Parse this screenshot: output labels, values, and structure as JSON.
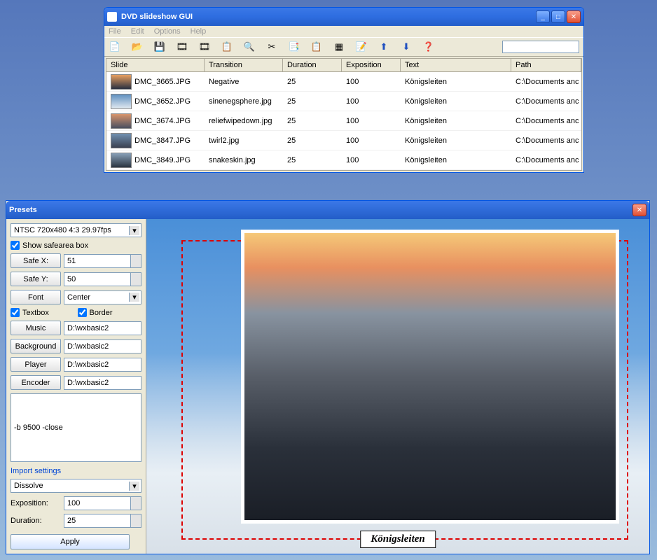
{
  "main": {
    "title": "DVD slideshow GUI",
    "menu": [
      "File",
      "Edit",
      "Options",
      "Help"
    ],
    "columns": [
      "Slide",
      "Transition",
      "Duration",
      "Exposition",
      "Text",
      "Path"
    ],
    "rows": [
      {
        "slide": "DMC_3665.JPG",
        "trans": "Negative",
        "dur": "25",
        "exp": "100",
        "text": "Königsleiten",
        "path": "C:\\Documents anc"
      },
      {
        "slide": "DMC_3652.JPG",
        "trans": "sinenegsphere.jpg",
        "dur": "25",
        "exp": "100",
        "text": "Königsleiten",
        "path": "C:\\Documents anc"
      },
      {
        "slide": "DMC_3674.JPG",
        "trans": "reliefwipedown.jpg",
        "dur": "25",
        "exp": "100",
        "text": "Königsleiten",
        "path": "C:\\Documents anc"
      },
      {
        "slide": "DMC_3847.JPG",
        "trans": "twirl2.jpg",
        "dur": "25",
        "exp": "100",
        "text": "Königsleiten",
        "path": "C:\\Documents anc"
      },
      {
        "slide": "DMC_3849.JPG",
        "trans": "snakeskin.jpg",
        "dur": "25",
        "exp": "100",
        "text": "Königsleiten",
        "path": "C:\\Documents anc"
      }
    ],
    "thumbs": [
      "linear-gradient(#e8a060,#2a3040)",
      "linear-gradient(#6090c0,#e0e8f0)",
      "linear-gradient(#d8946c,#4a5060)",
      "linear-gradient(#7090b0,#3a4050)",
      "linear-gradient(#88a0b8,#2a3440)"
    ]
  },
  "presets": {
    "title": "Presets",
    "format": "NTSC 720x480 4:3 29.97fps",
    "safearea_label": "Show safearea box",
    "safex_btn": "Safe X:",
    "safex_val": "51",
    "safey_btn": "Safe Y:",
    "safey_val": "50",
    "font_btn": "Font",
    "font_val": "Center",
    "textbox_label": "Textbox",
    "border_label": "Border",
    "music_btn": "Music",
    "music_val": "D:\\wxbasic2",
    "bg_btn": "Background",
    "bg_val": "D:\\wxbasic2",
    "player_btn": "Player",
    "player_val": "D:\\wxbasic2",
    "encoder_btn": "Encoder",
    "encoder_val": "D:\\wxbasic2",
    "cmdline": "-b 9500 -close",
    "import_label": "Import settings",
    "transition": "Dissolve",
    "exp_label": "Exposition:",
    "exp_val": "100",
    "dur_label": "Duration:",
    "dur_val": "25",
    "apply": "Apply",
    "caption": "Königsleiten"
  }
}
